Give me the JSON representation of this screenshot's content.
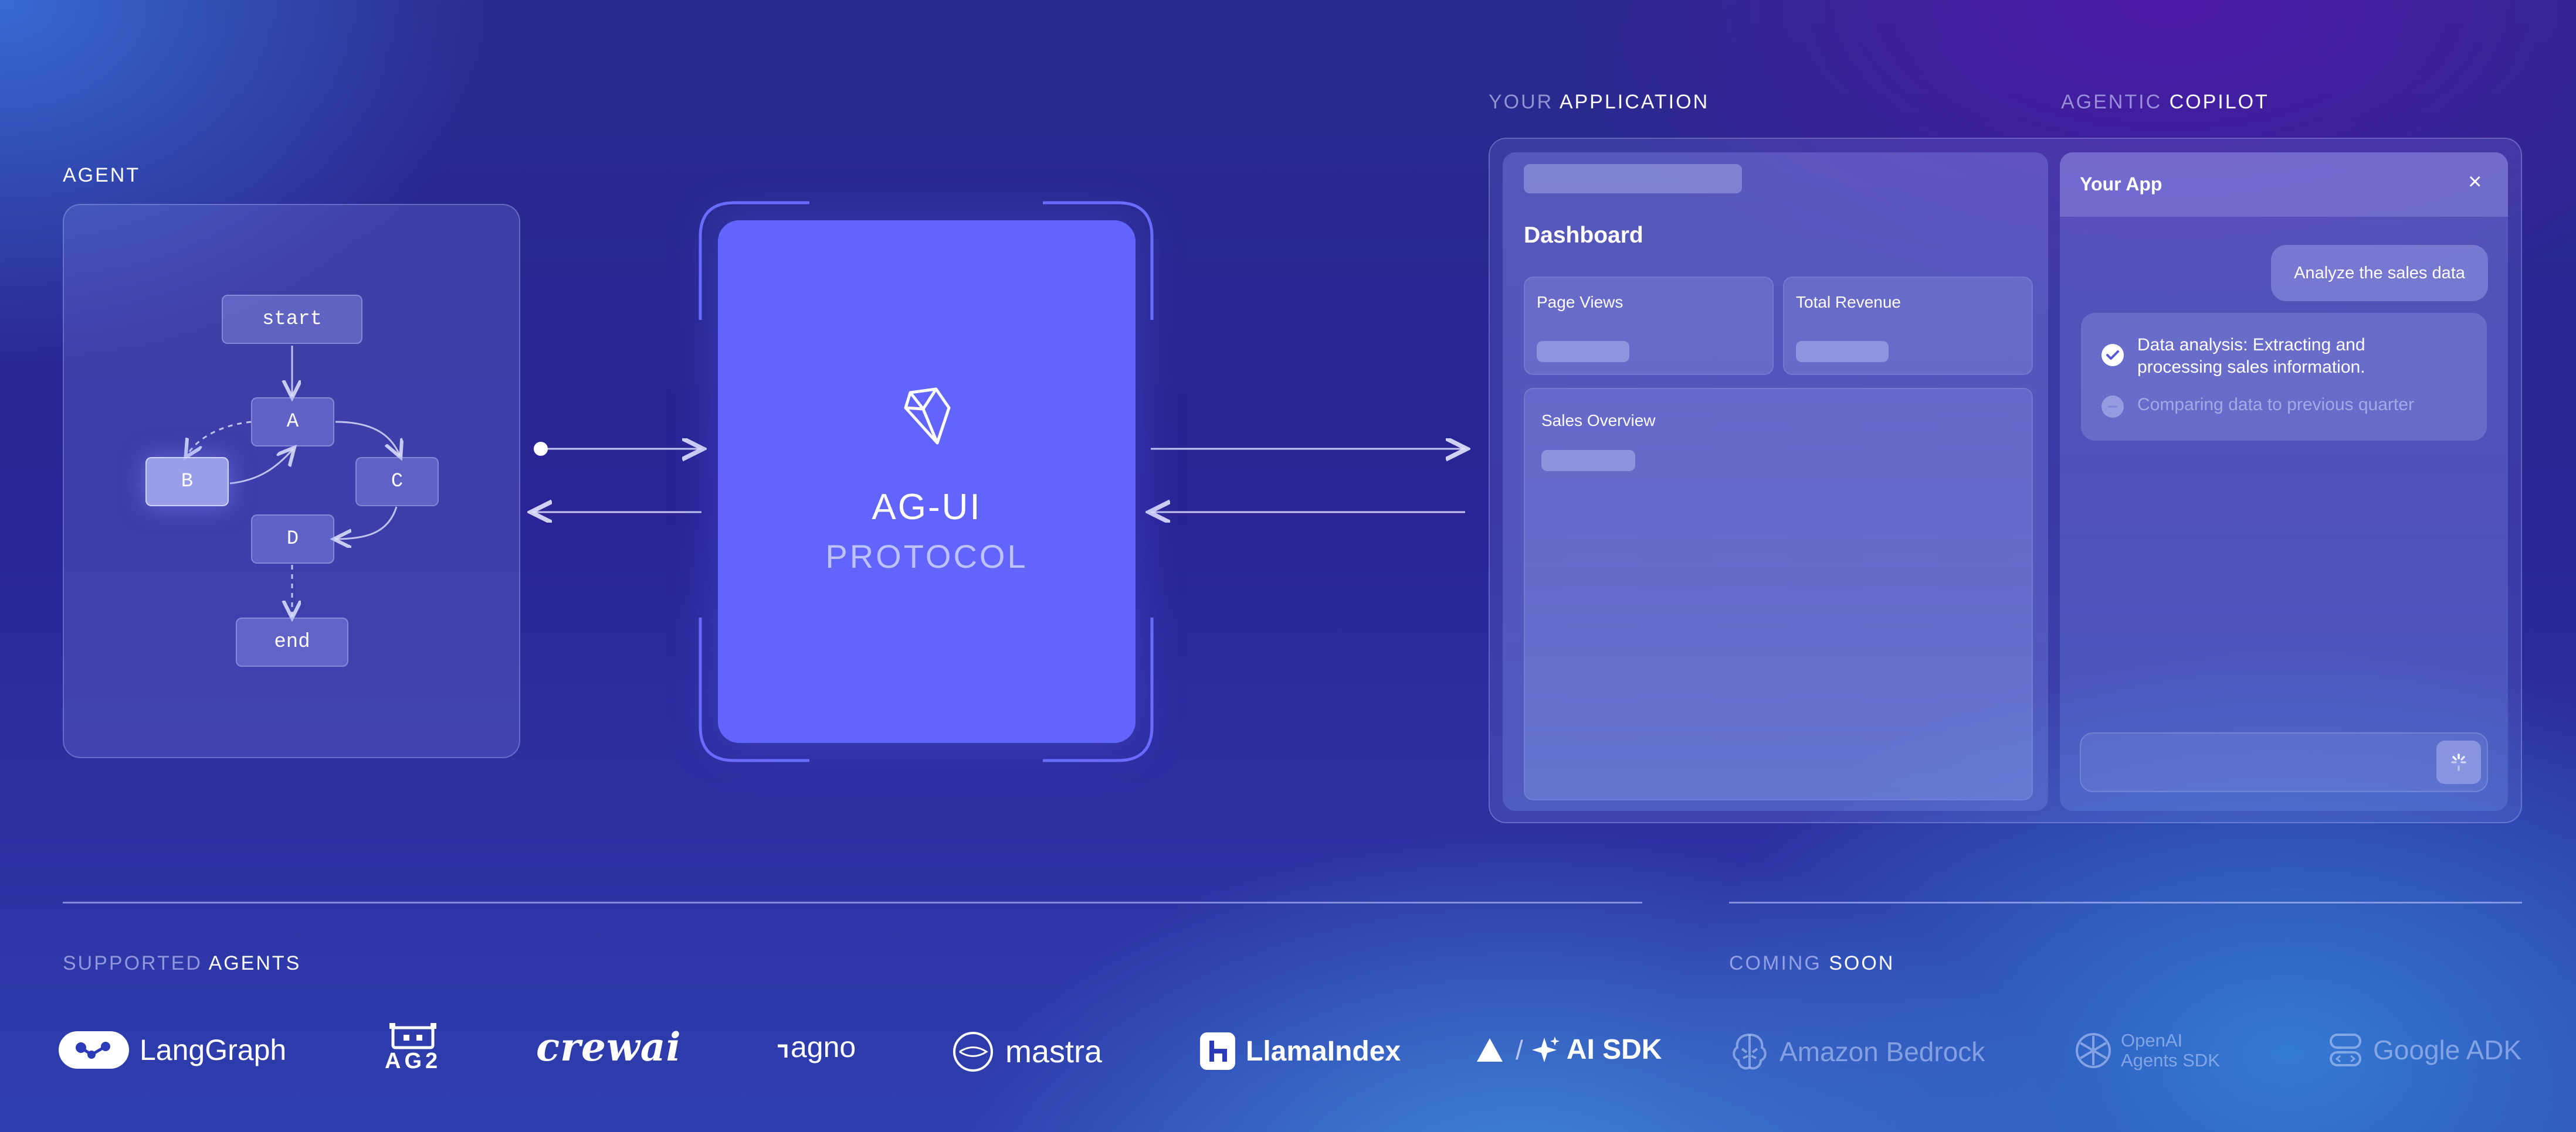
{
  "agent": {
    "label": "AGENT",
    "nodes": {
      "start": "start",
      "a": "A",
      "b": "B",
      "c": "C",
      "d": "D",
      "end": "end"
    }
  },
  "protocol": {
    "title": "AG-UI",
    "subtitle": "PROTOCOL",
    "icon": "diamond-gem-icon"
  },
  "your_application": {
    "label_dim": "YOUR",
    "label_bright": "APPLICATION",
    "dashboard_title": "Dashboard",
    "cards": [
      "Page Views",
      "Total Revenue"
    ],
    "overview_title": "Sales Overview"
  },
  "copilot": {
    "label_dim": "AGENTIC",
    "label_bright": "COPILOT",
    "app_title": "Your App",
    "close_icon": "×",
    "user_message": "Analyze the sales data",
    "steps": {
      "done_line1": "Data analysis: Extracting and",
      "done_line2": "processing sales information.",
      "pending": "Comparing data to previous quarter"
    }
  },
  "supported": {
    "label_dim": "SUPPORTED",
    "label_bright": "AGENTS",
    "logos": {
      "langgraph": "LangGraph",
      "ag2": "AG2",
      "crewai": "crewai",
      "agno": "agno",
      "mastra": "mastra",
      "llamaindex": "LlamaIndex",
      "aisdk_slash": "/",
      "aisdk": "AI SDK"
    }
  },
  "coming_soon": {
    "label_dim": "COMING",
    "label_bright": "SOON",
    "logos": {
      "bedrock": "Amazon Bedrock",
      "openai_line1": "OpenAI",
      "openai_line2": "Agents SDK",
      "google_adk": "Google ADK"
    }
  },
  "colors": {
    "protocol_card": "#6265fb",
    "background_top": "#2a2b8c",
    "background_accent": "#3f8cdc",
    "text": "#ffffff"
  }
}
